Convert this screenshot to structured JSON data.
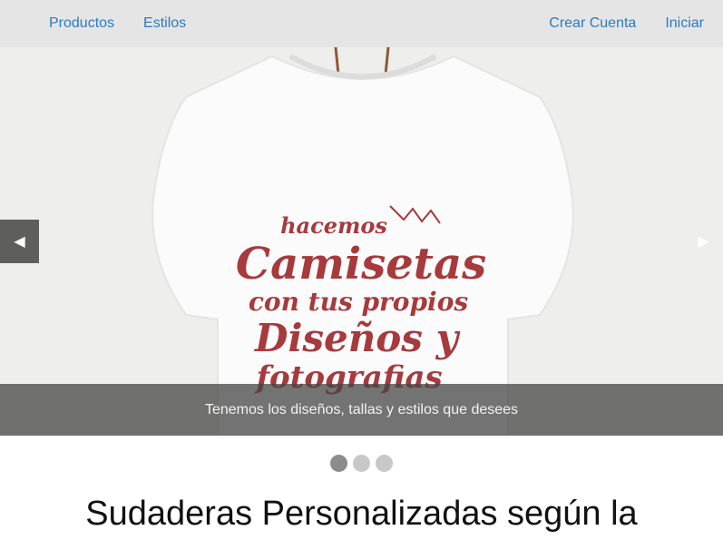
{
  "nav": {
    "left": [
      "Productos",
      "Estilos"
    ],
    "right": [
      "Crear Cuenta",
      "Iniciar"
    ]
  },
  "carousel": {
    "prev_icon": "◀",
    "next_icon": "▶",
    "caption": "Tenemos los diseños, tallas y estilos que desees",
    "slide_text": [
      "hacemos",
      "Camisetas",
      "con tus propios",
      "Diseños y",
      "fotografias"
    ],
    "slide_count": 3,
    "active_slide": 1
  },
  "main": {
    "heading": "Sudaderas Personalizadas según la"
  },
  "colors": {
    "link": "#2b7bbf",
    "shirt_text": "#a63a3d",
    "caption_bg": "#464646"
  }
}
